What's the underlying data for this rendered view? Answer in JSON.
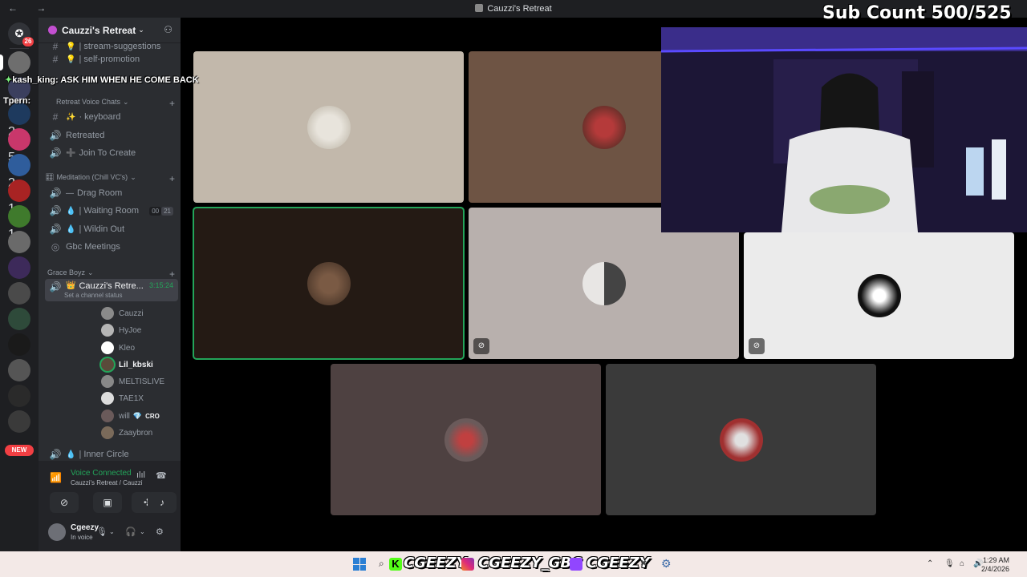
{
  "window": {
    "title": "Cauzzi's Retreat",
    "nav": "← →"
  },
  "overlay": {
    "sub_count": "Sub Count 500/525",
    "chat_user": "kash_king:",
    "chat_message": "ASK HIM WHEN HE COME BACK",
    "chat_user2": "Tpern:"
  },
  "rail": {
    "home_badge": "26",
    "badges": [
      "2",
      "5",
      "2",
      "1",
      "1"
    ],
    "new_label": "NEW"
  },
  "sidebar": {
    "guild_name": "Cauzzi's Retreat",
    "channels_top": [
      {
        "prefix": "#",
        "emoji": "💡",
        "label": "| stream-suggestions"
      },
      {
        "prefix": "#",
        "emoji": "💡",
        "label": "| self-promotion"
      }
    ],
    "category1": "Retreat Voice Chats",
    "voice1": [
      {
        "prefix": "#",
        "emoji": "✨",
        "label": "· keyboard"
      },
      {
        "prefix": "🔊",
        "emoji": "",
        "label": "Retreated"
      },
      {
        "prefix": "🔊",
        "emoji": "➕",
        "label": "Join To Create"
      }
    ],
    "category2": "Meditation (Chill VC's)",
    "voice2": [
      {
        "prefix": "🔊",
        "emoji": "—",
        "label": "Drag Room"
      },
      {
        "prefix": "🔊",
        "emoji": "💧",
        "label": "| Waiting Room",
        "tag1": "00",
        "tag2": "21"
      },
      {
        "prefix": "🔊",
        "emoji": "💧",
        "label": "| Wildin Out"
      },
      {
        "prefix": "◎",
        "emoji": "",
        "label": "Gbc Meetings"
      }
    ],
    "category3": "Grace Boyz",
    "active_channel": {
      "label": "Cauzzi's Retre...",
      "timer": "3:15:24",
      "status": "Set a channel status"
    },
    "voice_users": [
      "Cauzzi",
      "HyJoe",
      "Kleo",
      "Lil_kbski",
      "MELTISLIVE",
      "TAE1X",
      "will",
      "Zaaybron"
    ],
    "will_tag": "CRO",
    "inner_circle": "| Inner Circle",
    "voice_panel": {
      "status": "Voice Connected",
      "sub": "Cauzzi's Retreat / Cauzzi's R..."
    },
    "user": {
      "name": "Cgeezy",
      "status": "In voice"
    }
  },
  "taskbar": {
    "social1": "CGEEZY",
    "social2": "CGEEZY_GBC",
    "social3": "CGEEZY",
    "time": "1:29 AM",
    "date": "2/4/2026"
  },
  "colors": {
    "accent_green": "#23a55a",
    "sidebar_bg": "#2b2d31",
    "rail_bg": "#1e1f22"
  }
}
